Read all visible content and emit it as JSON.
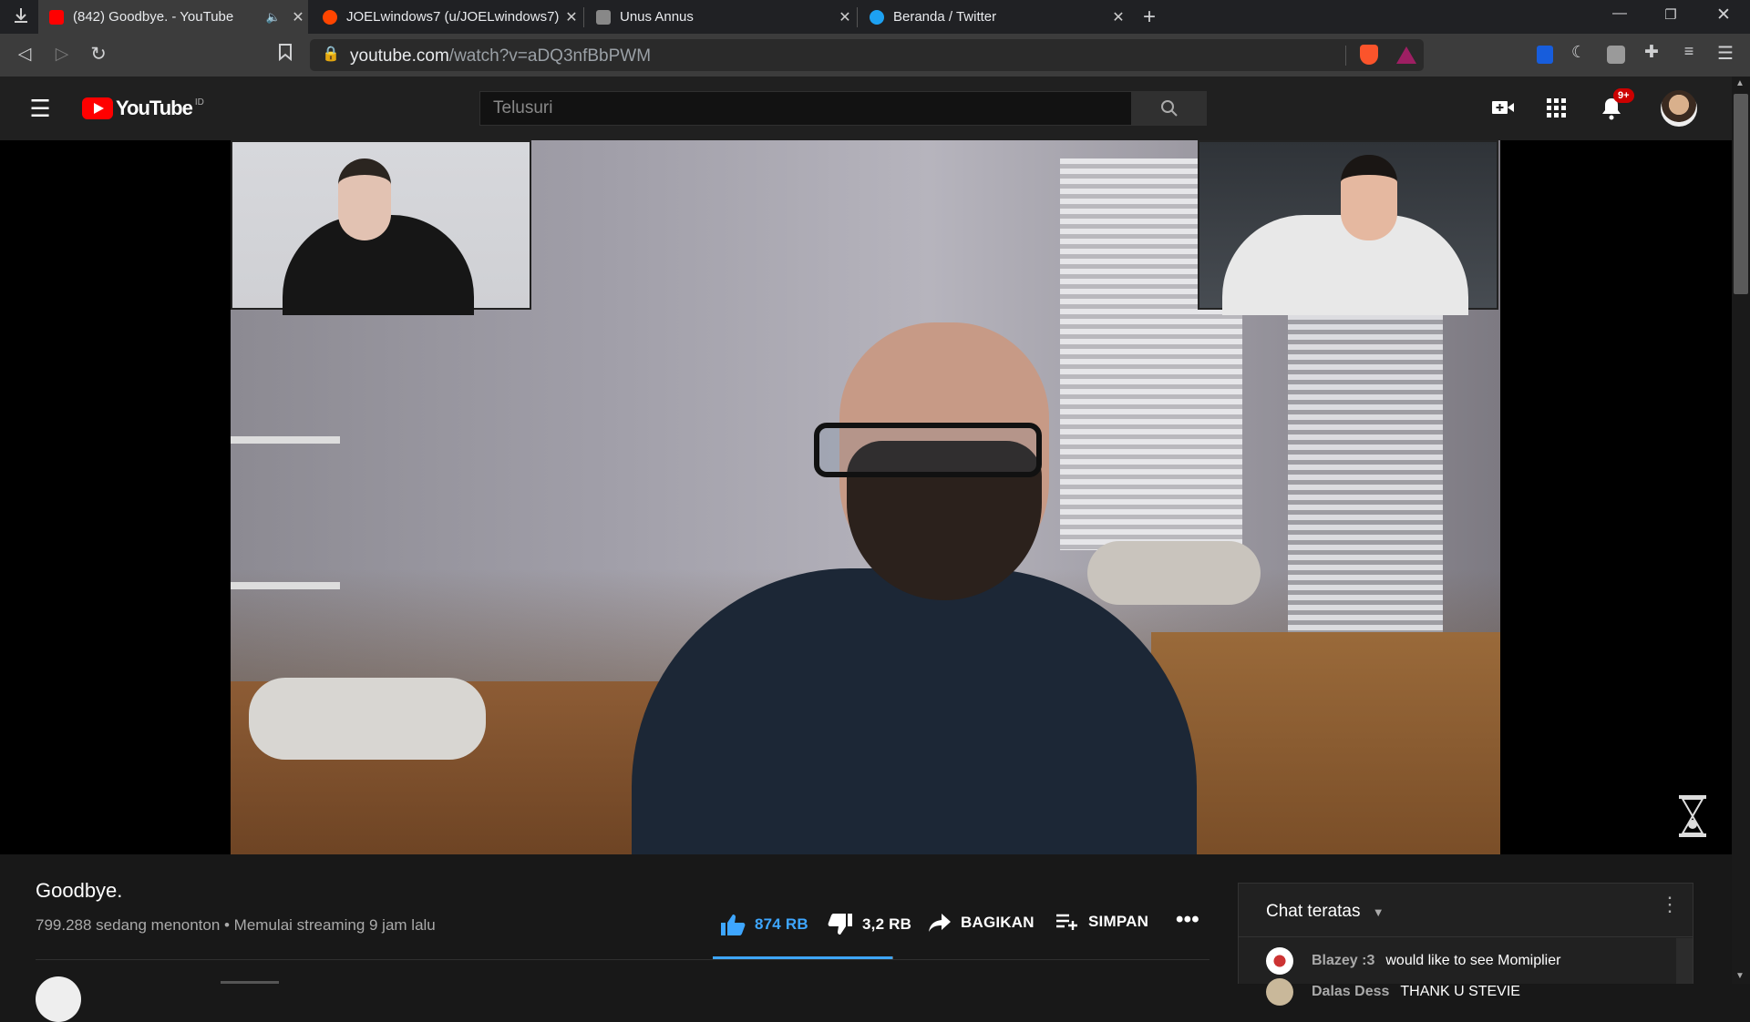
{
  "browser": {
    "tabs": [
      {
        "title": "(842) Goodbye. - YouTube",
        "favicon": "youtube-icon",
        "active": true
      },
      {
        "title": "JOELwindows7 (u/JOELwindows7) -",
        "favicon": "reddit-icon",
        "active": false
      },
      {
        "title": "Unus Annus",
        "favicon": "page-icon",
        "active": false
      },
      {
        "title": "Beranda / Twitter",
        "favicon": "twitter-icon",
        "active": false
      }
    ],
    "url_host": "youtube.com",
    "url_path": "/watch?v=aDQ3nfBbPWM"
  },
  "header": {
    "logo_text": "YouTube",
    "region": "ID",
    "search_placeholder": "Telusuri",
    "notification_count": "9+"
  },
  "video": {
    "title": "Goodbye.",
    "meta": "799.288 sedang menonton • Memulai streaming 9 jam lalu",
    "likes": "874 RB",
    "dislikes": "3,2 RB",
    "share_label": "BAGIKAN",
    "save_label": "SIMPAN",
    "like_ratio": 0.996
  },
  "chat": {
    "title": "Chat teratas",
    "messages": [
      {
        "author": "Blazey :3",
        "text": "would like to see Momiplier"
      },
      {
        "author": "Dalas Dess",
        "text": "THANK U STEVIE"
      }
    ]
  },
  "colors": {
    "youtube_red": "#ff0000",
    "like_blue": "#3ea6ff",
    "badge_red": "#cc0000"
  }
}
